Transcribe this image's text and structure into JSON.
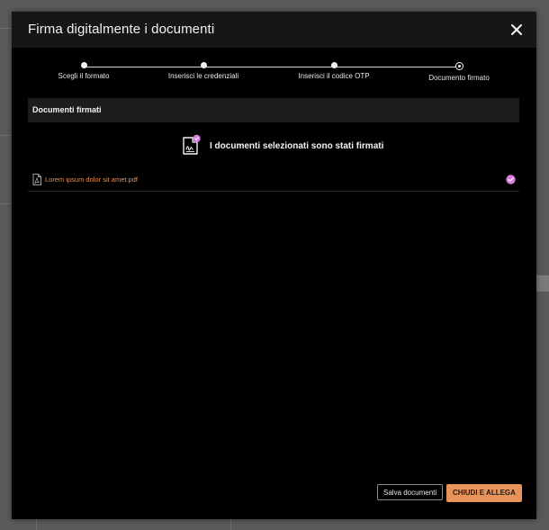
{
  "dialog": {
    "title": "Firma digitalmente i documenti",
    "close_icon": "close-icon"
  },
  "stepper": {
    "steps": [
      {
        "label": "Scegli il formato",
        "state": "done"
      },
      {
        "label": "Inserisci le credenziali",
        "state": "done"
      },
      {
        "label": "Inserisci il codice OTP",
        "state": "done"
      },
      {
        "label": "Documento firmato",
        "state": "current"
      }
    ]
  },
  "section": {
    "title": "Documenti firmati"
  },
  "status": {
    "message": "I documenti selezionati sono stati firmati",
    "icon": "signed-document-icon"
  },
  "files": [
    {
      "name": "Lorem ipsum dolor sit amet.pdf",
      "icon": "pdf-icon",
      "status_icon": "check-circle-icon"
    }
  ],
  "footer": {
    "save_label": "Salva documenti",
    "close_attach_label": "CHIUDI E ALLEGA"
  },
  "colors": {
    "accent": "#e8935a",
    "check": "#d97ee0",
    "background": "#000000",
    "header": "#161616",
    "section_bar": "#1c1c1c"
  }
}
